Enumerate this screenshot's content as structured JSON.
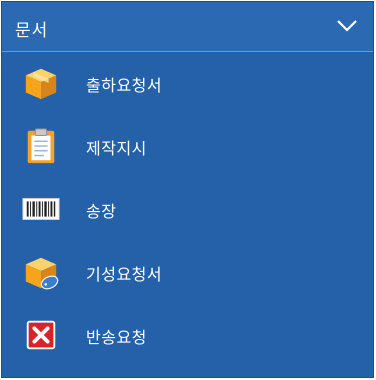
{
  "header": {
    "title": "문서",
    "chevron_icon": "chevron-down-icon"
  },
  "menu": {
    "items": [
      {
        "label": "출하요청서",
        "icon": "box-icon"
      },
      {
        "label": "제작지시",
        "icon": "clipboard-icon"
      },
      {
        "label": "송장",
        "icon": "barcode-icon"
      },
      {
        "label": "기성요청서",
        "icon": "box-tag-icon"
      },
      {
        "label": "반송요청",
        "icon": "close-icon"
      }
    ]
  },
  "colors": {
    "panel_bg": "#2561a8",
    "header_bg": "#2b69b3",
    "text": "#ffffff",
    "close_red": "#d8232a",
    "box_orange": "#f2a41f"
  }
}
